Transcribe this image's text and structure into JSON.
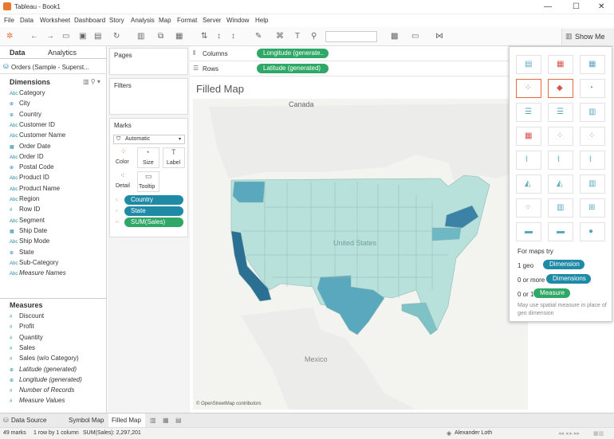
{
  "window": {
    "title": "Tableau - Book1"
  },
  "menu": [
    "File",
    "Data",
    "Worksheet",
    "Dashboard",
    "Story",
    "Analysis",
    "Map",
    "Format",
    "Server",
    "Window",
    "Help"
  ],
  "toolbar": {
    "show_me": "Show Me"
  },
  "left": {
    "tabs": [
      "Data",
      "Analytics"
    ],
    "datasource": "Orders (Sample - Superst...",
    "dimensions_title": "Dimensions",
    "dimensions": [
      {
        "type": "Abc",
        "label": "Category"
      },
      {
        "type": "geo",
        "label": "City"
      },
      {
        "type": "geo",
        "label": "Country"
      },
      {
        "type": "Abc",
        "label": "Customer ID"
      },
      {
        "type": "Abc",
        "label": "Customer Name"
      },
      {
        "type": "date",
        "label": "Order Date"
      },
      {
        "type": "Abc",
        "label": "Order ID"
      },
      {
        "type": "geo",
        "label": "Postal Code"
      },
      {
        "type": "Abc",
        "label": "Product ID"
      },
      {
        "type": "Abc",
        "label": "Product Name"
      },
      {
        "type": "Abc",
        "label": "Region"
      },
      {
        "type": "#",
        "label": "Row ID"
      },
      {
        "type": "Abc",
        "label": "Segment"
      },
      {
        "type": "date",
        "label": "Ship Date"
      },
      {
        "type": "Abc",
        "label": "Ship Mode"
      },
      {
        "type": "geo",
        "label": "State"
      },
      {
        "type": "Abc",
        "label": "Sub-Category"
      },
      {
        "type": "Abc",
        "label": "Measure Names"
      }
    ],
    "measures_title": "Measures",
    "measures": [
      {
        "type": "#",
        "label": "Discount"
      },
      {
        "type": "#",
        "label": "Profit"
      },
      {
        "type": "#",
        "label": "Quantity"
      },
      {
        "type": "#",
        "label": "Sales"
      },
      {
        "type": "#",
        "label": "Sales (w/o Category)"
      },
      {
        "type": "geo",
        "label": "Latitude (generated)"
      },
      {
        "type": "geo",
        "label": "Longitude (generated)"
      },
      {
        "type": "#",
        "label": "Number of Records"
      },
      {
        "type": "#",
        "label": "Measure Values"
      }
    ]
  },
  "cards": {
    "pages": "Pages",
    "filters": "Filters",
    "marks": "Marks",
    "mark_type": "Automatic",
    "buttons": [
      "Color",
      "Size",
      "Label",
      "Detail",
      "Tooltip"
    ],
    "mark_pills": [
      "Country",
      "State",
      "SUM(Sales)"
    ]
  },
  "shelves": {
    "columns_label": "Columns",
    "columns_pill": "Longitude (generate..",
    "rows_label": "Rows",
    "rows_pill": "Latitude (generated)"
  },
  "view": {
    "title": "Filled Map",
    "map_labels": [
      "Canada",
      "United States",
      "Mexico"
    ],
    "attribution": "© OpenStreetMap contributors"
  },
  "showme": {
    "hint_intro": "For maps try",
    "req1_prefix": "1 geo",
    "req1_pill": "Dimension",
    "req2_prefix": "0 or more",
    "req2_pill": "Dimensions",
    "req3_prefix": "0 or 1",
    "req3_pill": "Measure",
    "note": "May use spatial measure in place of geo dimension"
  },
  "bottom": {
    "tabs": [
      "Data Source",
      "Symbol Map",
      "Filled Map"
    ]
  },
  "status": {
    "marks": "49 marks",
    "dims": "1 row by 1 column",
    "sum": "SUM(Sales): 2,297,201",
    "user": "Alexander Loth"
  },
  "colors": {
    "teal": "#1f8aa6",
    "green": "#2fa766",
    "dark_state": "#2b6f93",
    "light_state": "#b9e1dc",
    "map_bg": "#f3f3f0"
  }
}
